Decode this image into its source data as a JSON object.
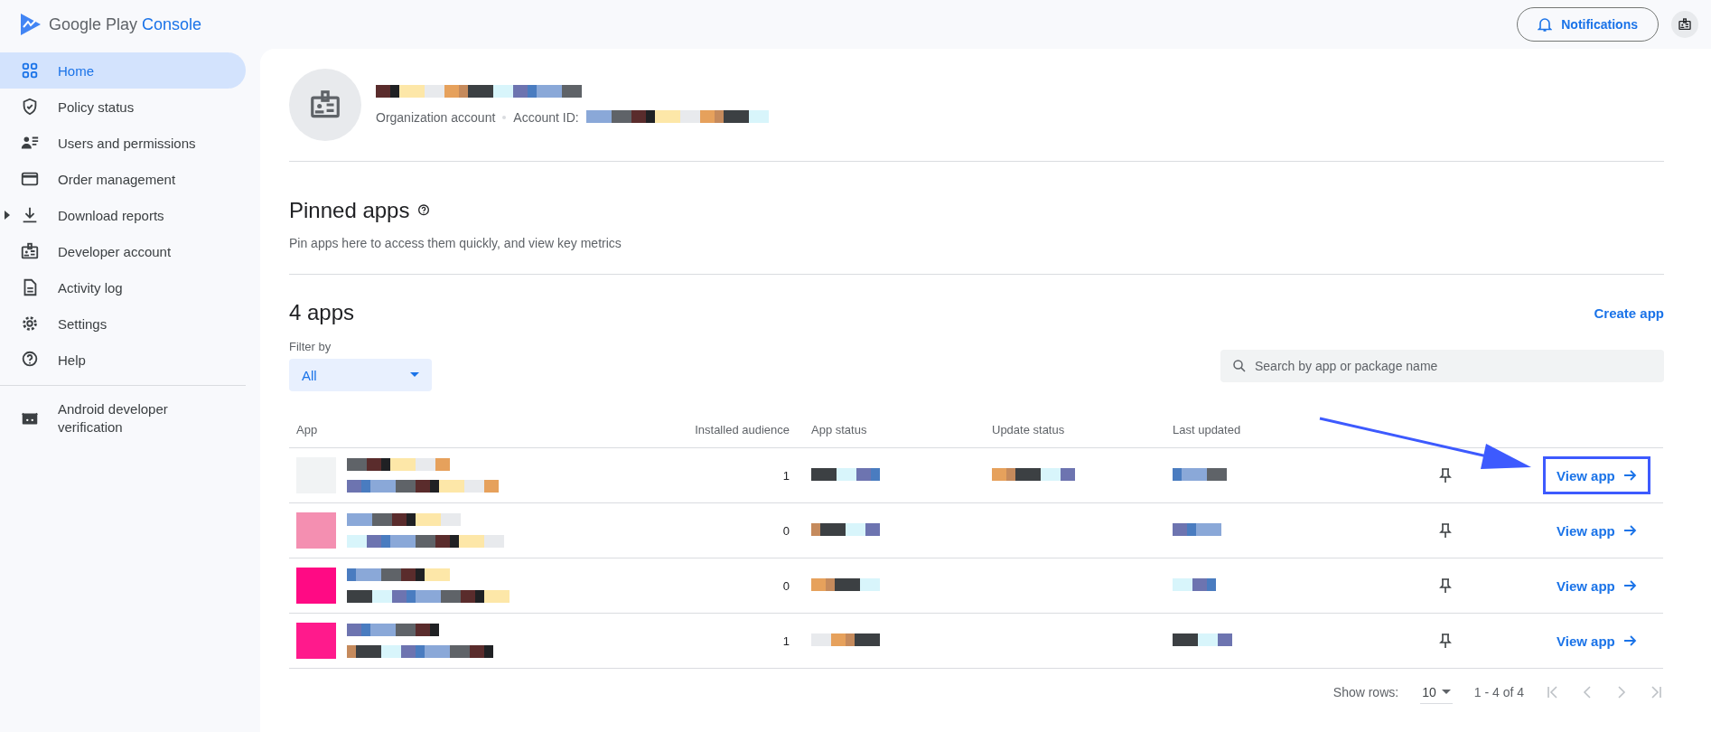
{
  "logo": {
    "brand": "Google Play",
    "product": "Console"
  },
  "header": {
    "notifications": "Notifications"
  },
  "sidebar": {
    "items": [
      {
        "label": "Home",
        "selected": true,
        "expandable": false
      },
      {
        "label": "Policy status",
        "selected": false,
        "expandable": false
      },
      {
        "label": "Users and permissions",
        "selected": false,
        "expandable": false
      },
      {
        "label": "Order management",
        "selected": false,
        "expandable": false
      },
      {
        "label": "Download reports",
        "selected": false,
        "expandable": true
      },
      {
        "label": "Developer account",
        "selected": false,
        "expandable": false
      },
      {
        "label": "Activity log",
        "selected": false,
        "expandable": false
      },
      {
        "label": "Settings",
        "selected": false,
        "expandable": false
      },
      {
        "label": "Help",
        "selected": false,
        "expandable": false
      }
    ],
    "footer_item": {
      "label": "Android developer verification",
      "selected": false
    }
  },
  "account": {
    "type": "Organization account",
    "id_label": "Account ID:"
  },
  "pinned": {
    "title": "Pinned apps",
    "description": "Pin apps here to access them quickly, and view key metrics"
  },
  "apps": {
    "title": "4 apps",
    "create": "Create app",
    "filter_label": "Filter by",
    "filter_value": "All",
    "search": {
      "placeholder": "Search by app or package name"
    },
    "columns": [
      "App",
      "Installed audience",
      "App status",
      "Update status",
      "Last updated"
    ],
    "rows": [
      {
        "color": "#f1f3f4",
        "audience": "1",
        "highlighted": true,
        "action": "View app"
      },
      {
        "color": "#f48fb1",
        "audience": "0",
        "highlighted": false,
        "action": "View app"
      },
      {
        "color": "#ff0a84",
        "audience": "0",
        "highlighted": false,
        "action": "View app"
      },
      {
        "color": "#ff1a8c",
        "audience": "1",
        "highlighted": false,
        "action": "View app"
      }
    ],
    "pagination": {
      "label": "Show rows:",
      "rows": "10",
      "range": "1 - 4 of 4"
    }
  }
}
